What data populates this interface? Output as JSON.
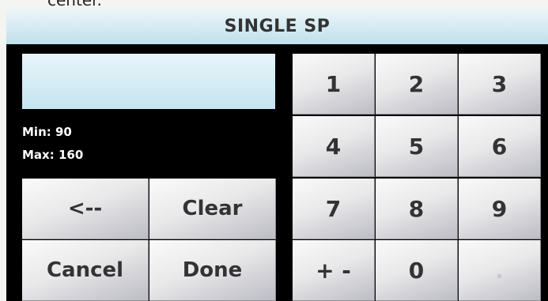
{
  "caption_fragment": "center.",
  "title": "SINGLE SP",
  "display": {
    "value": ""
  },
  "limits": {
    "min": "Min: 90",
    "max": "Max: 160"
  },
  "keypad": {
    "k1": "1",
    "k2": "2",
    "k3": "3",
    "k4": "4",
    "k5": "5",
    "k6": "6",
    "k7": "7",
    "k8": "8",
    "k9": "9",
    "sign": "+ -",
    "k0": "0",
    "dot": "."
  },
  "actions": {
    "backspace": "<--",
    "clear": "Clear",
    "cancel": "Cancel",
    "done": "Done"
  }
}
